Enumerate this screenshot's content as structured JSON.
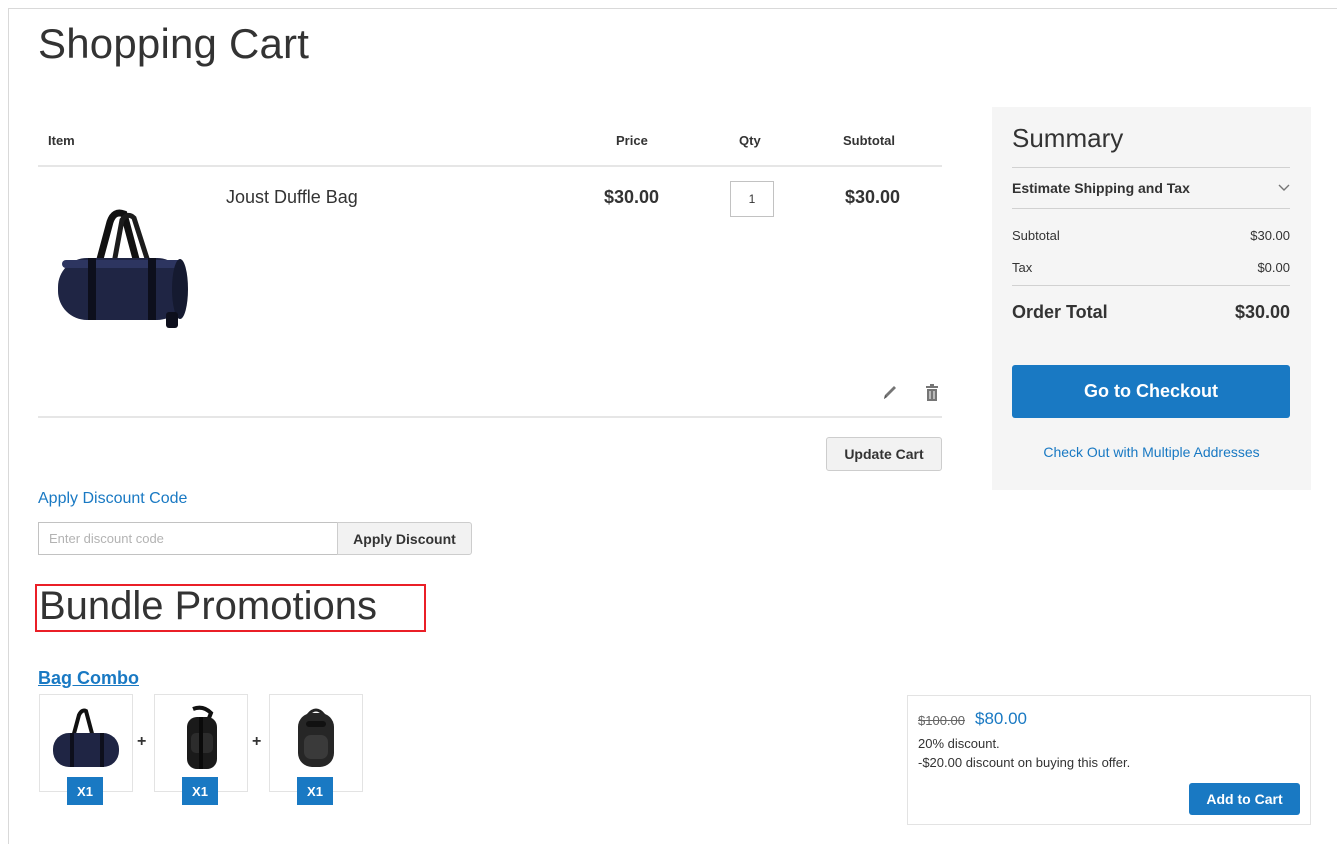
{
  "page": {
    "title": "Shopping Cart"
  },
  "cart": {
    "columns": {
      "item": "Item",
      "price": "Price",
      "qty": "Qty",
      "subtotal": "Subtotal"
    },
    "items": [
      {
        "name": "Joust Duffle Bag",
        "price": "$30.00",
        "qty": "1",
        "subtotal": "$30.00",
        "image": "duffle-bag-image"
      }
    ],
    "update_label": "Update Cart"
  },
  "discount": {
    "link_label": "Apply Discount Code",
    "placeholder": "Enter discount code",
    "button_label": "Apply Discount"
  },
  "summary": {
    "title": "Summary",
    "estimate_label": "Estimate Shipping and Tax",
    "subtotal_label": "Subtotal",
    "subtotal_value": "$30.00",
    "tax_label": "Tax",
    "tax_value": "$0.00",
    "total_label": "Order Total",
    "total_value": "$30.00",
    "checkout_label": "Go to Checkout",
    "multi_label": "Check Out with Multiple Addresses"
  },
  "bundle": {
    "title": "Bundle Promotions",
    "combo_name": "Bag Combo",
    "products": [
      {
        "image": "duffle-bag-image",
        "qty_badge": "X1"
      },
      {
        "image": "sling-backpack-image",
        "qty_badge": "X1"
      },
      {
        "image": "backpack-image",
        "qty_badge": "X1"
      }
    ],
    "plus_sign": "+",
    "old_price": "$100.00",
    "new_price": "$80.00",
    "discount_line": "20% discount.",
    "savings_line": "-$20.00 discount on buying this offer.",
    "add_label": "Add to Cart"
  },
  "colors": {
    "accent": "#1979c3",
    "highlight_border": "#ea1f27",
    "summary_bg": "#f5f5f5",
    "button_gray": "#f2f2f2"
  }
}
